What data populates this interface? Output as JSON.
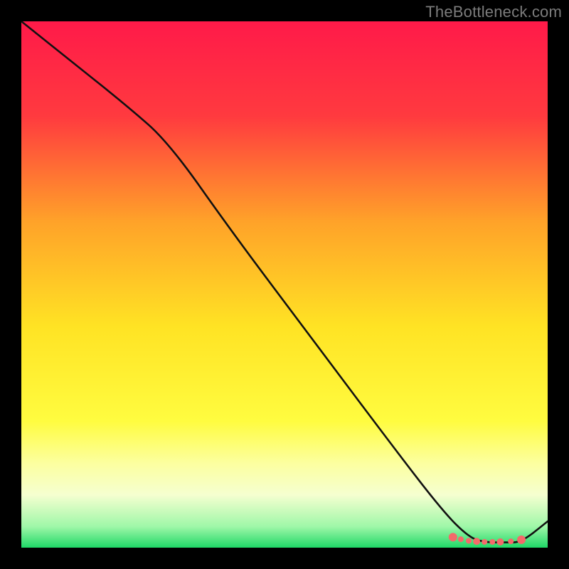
{
  "attribution": "TheBottleneck.com",
  "chart_data": {
    "type": "line",
    "title": "",
    "xlabel": "",
    "ylabel": "",
    "xlim": [
      0,
      100
    ],
    "ylim": [
      0,
      100
    ],
    "gradient_stops": [
      {
        "offset": 0,
        "color": "#ff1a49"
      },
      {
        "offset": 18,
        "color": "#ff3a3f"
      },
      {
        "offset": 38,
        "color": "#ffa229"
      },
      {
        "offset": 58,
        "color": "#ffe324"
      },
      {
        "offset": 76,
        "color": "#fffc40"
      },
      {
        "offset": 84,
        "color": "#fcffa0"
      },
      {
        "offset": 90,
        "color": "#f5ffd0"
      },
      {
        "offset": 96,
        "color": "#9ff7a8"
      },
      {
        "offset": 100,
        "color": "#1fd867"
      }
    ],
    "series": [
      {
        "name": "bottleneck-curve",
        "x": [
          0,
          10,
          20,
          28,
          40,
          55,
          70,
          80,
          85,
          88,
          92,
          95,
          100
        ],
        "y": [
          100,
          92,
          84,
          77,
          60,
          40,
          20,
          7,
          2,
          1,
          1,
          1,
          5
        ]
      }
    ],
    "markers": [
      {
        "x": 82,
        "y": 2.0,
        "r": 6
      },
      {
        "x": 83.5,
        "y": 1.6,
        "r": 4
      },
      {
        "x": 85,
        "y": 1.3,
        "r": 4
      },
      {
        "x": 86.5,
        "y": 1.2,
        "r": 5
      },
      {
        "x": 88,
        "y": 1.1,
        "r": 4
      },
      {
        "x": 89.5,
        "y": 1.1,
        "r": 4
      },
      {
        "x": 91,
        "y": 1.1,
        "r": 5
      },
      {
        "x": 93,
        "y": 1.2,
        "r": 4
      },
      {
        "x": 95,
        "y": 1.5,
        "r": 6
      }
    ],
    "marker_color": "#f46a6a",
    "line_color": "#111111"
  }
}
